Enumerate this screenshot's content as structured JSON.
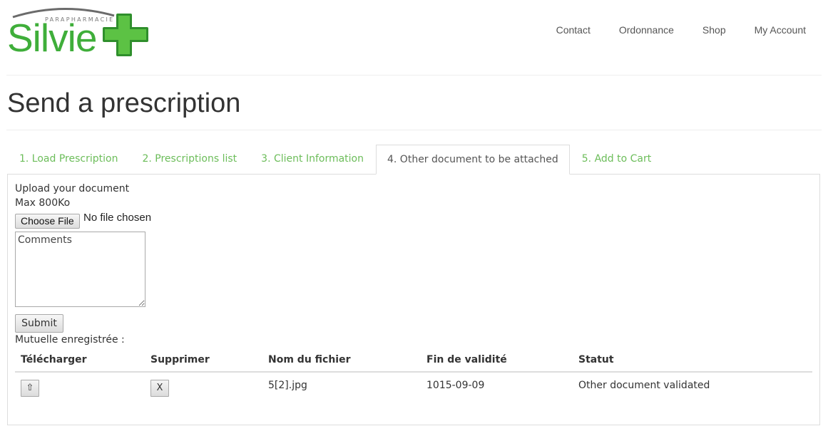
{
  "header": {
    "logo": {
      "subtitle": "PARAPHARMACIE",
      "word": "Silvie",
      "brand_green": "#3fae3a"
    },
    "nav": [
      "Contact",
      "Ordonnance",
      "Shop",
      "My Account"
    ]
  },
  "page_title": "Send a prescription",
  "tabs": [
    {
      "label": "1. Load Prescription",
      "active": false
    },
    {
      "label": "2. Prescriptions list",
      "active": false
    },
    {
      "label": "3. Client Information",
      "active": false
    },
    {
      "label": "4. Other document to be attached",
      "active": true
    },
    {
      "label": "5. Add to Cart",
      "active": false
    }
  ],
  "form": {
    "upload_label": "Upload your document",
    "max_size": "Max 800Ko",
    "choose_file_label": "Choose File",
    "file_status": "No file chosen",
    "comments_placeholder": "Comments",
    "submit_label": "Submit",
    "registered_label": "Mutuelle enregistrée :"
  },
  "table": {
    "headers": [
      "Télécharger",
      "Supprimer",
      "Nom du fichier",
      "Fin de validité",
      "Statut"
    ],
    "rows": [
      {
        "download_icon": "upload-arrow-icon",
        "download_glyph": "⇧",
        "delete_glyph": "X",
        "filename": "5[2].jpg",
        "validity_end": "1015-09-09",
        "status": "Other document validated"
      }
    ]
  },
  "colors": {
    "tab_link": "#6cbd5a",
    "text": "#333333",
    "border": "#dddddd"
  }
}
